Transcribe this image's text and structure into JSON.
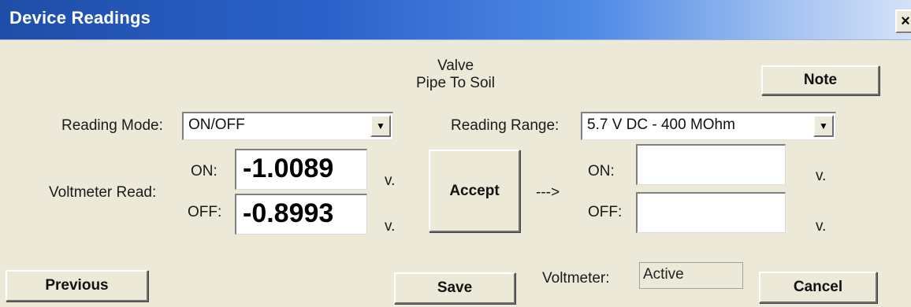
{
  "window": {
    "title": "Device Readings",
    "close_label": "×"
  },
  "header": {
    "line1": "Valve",
    "line2": "Pipe To Soil"
  },
  "buttons": {
    "note": "Note",
    "accept": "Accept",
    "previous": "Previous",
    "save": "Save",
    "cancel": "Cancel"
  },
  "reading_mode": {
    "label": "Reading Mode:",
    "value": "ON/OFF"
  },
  "reading_range": {
    "label": "Reading Range:",
    "value": "5.7 V DC - 400 MOhm"
  },
  "voltmeter_read": {
    "label": "Voltmeter Read:",
    "on_label": "ON:",
    "off_label": "OFF:",
    "on_value": "-1.0089",
    "off_value": "-0.8993",
    "unit": "v."
  },
  "accepted": {
    "arrow": "--->",
    "on_label": "ON:",
    "off_label": "OFF:",
    "on_value": "",
    "off_value": "",
    "unit": "v."
  },
  "voltmeter_status": {
    "label": "Voltmeter:",
    "value": "Active"
  },
  "icons": {
    "dropdown": "▼"
  }
}
